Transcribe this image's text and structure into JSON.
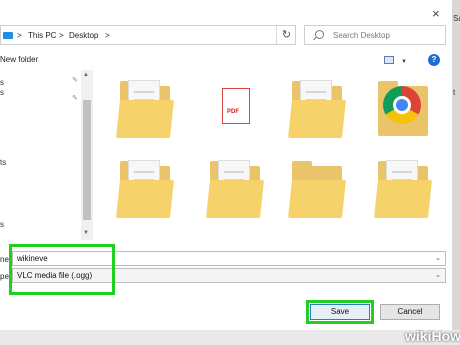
{
  "window": {
    "close_glyph": "×"
  },
  "address_bar": {
    "crumbs": [
      "This PC",
      "Desktop"
    ],
    "separator": ">",
    "refresh_glyph": "↻"
  },
  "search": {
    "placeholder": "Search Desktop"
  },
  "toolbar": {
    "new_folder_label": "New folder",
    "help_glyph": "?"
  },
  "nav_pane": {
    "items": [
      "s",
      "s",
      "ts",
      "s"
    ]
  },
  "files": [
    {
      "icon": "folder-with-documents-icon"
    },
    {
      "icon": "pdf-file-icon",
      "badge": "PDF"
    },
    {
      "icon": "folder-with-documents-icon"
    },
    {
      "icon": "chrome-icon"
    },
    {
      "icon": "folder-with-documents-icon"
    },
    {
      "icon": "folder-with-documents-icon"
    },
    {
      "icon": "folder-icon"
    },
    {
      "icon": "folder-with-documents-icon"
    }
  ],
  "form": {
    "filename_label": "ne",
    "filename_value": "wikineve",
    "filetype_label": "pe",
    "filetype_value": "VLC media file (.ogg)"
  },
  "buttons": {
    "save": "Save",
    "cancel": "Cancel"
  },
  "background_strip": {
    "text_top": "Sa",
    "text_mid": "t"
  },
  "watermark": {
    "wiki": "wiki",
    "how": "How"
  },
  "colors": {
    "highlight": "#20d020",
    "accent": "#1c6fd1"
  }
}
